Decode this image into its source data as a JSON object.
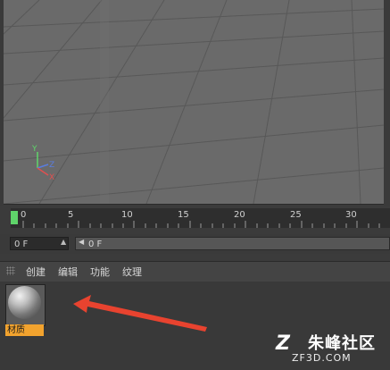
{
  "timeline": {
    "ticks": [
      "0",
      "5",
      "10",
      "15",
      "20",
      "25",
      "30"
    ],
    "current_frame": "0 F",
    "range_start": "0 F"
  },
  "menu": {
    "items": [
      "创建",
      "编辑",
      "功能",
      "纹理"
    ]
  },
  "material": {
    "name": "材质"
  },
  "axis": {
    "y": "Y",
    "z": "Z",
    "x": "X"
  },
  "watermark": {
    "logo": "Z",
    "name": "朱峰社区",
    "site": "ZF3D.COM"
  },
  "colors": {
    "playhead": "#5fd46a",
    "material_label_bg": "#f2a32e",
    "arrow": "#e8432f",
    "viewport_bg": "#6a6a6a"
  }
}
